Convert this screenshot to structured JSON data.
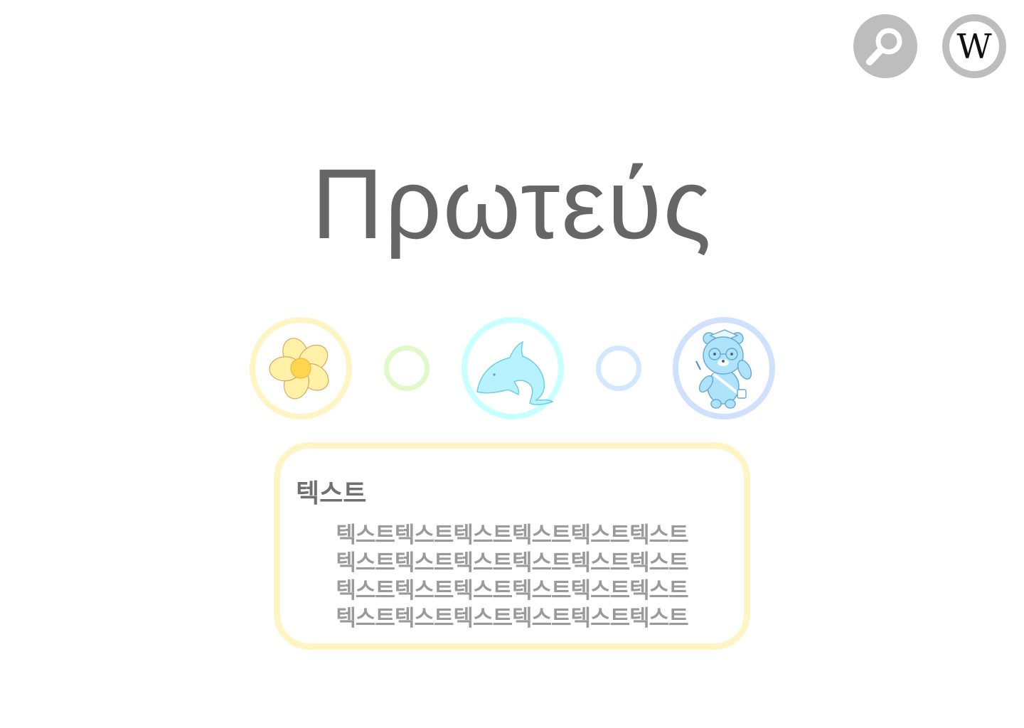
{
  "header": {
    "search_icon": "magnifier-icon",
    "wiki_icon": "wikipedia-w-icon",
    "wiki_glyph": "W"
  },
  "title": "Πρωτεύς",
  "circles": [
    {
      "kind": "image",
      "icon": "flower-icon",
      "border_color": "#fff4c4"
    },
    {
      "kind": "dot",
      "border_color": "#e1f8c8"
    },
    {
      "kind": "image",
      "icon": "dolphin-icon",
      "border_color": "#c8ffff"
    },
    {
      "kind": "dot",
      "border_color": "#d2e8ff"
    },
    {
      "kind": "image",
      "icon": "bear-icon",
      "border_color": "#d0e0ff"
    }
  ],
  "card": {
    "heading": "텍스트",
    "lines": [
      "텍스트텍스트텍스트텍스트텍스트텍스트",
      "텍스트텍스트텍스트텍스트텍스트텍스트",
      "텍스트텍스트텍스트텍스트텍스트텍스트",
      "텍스트텍스트텍스트텍스트텍스트텍스트"
    ]
  }
}
